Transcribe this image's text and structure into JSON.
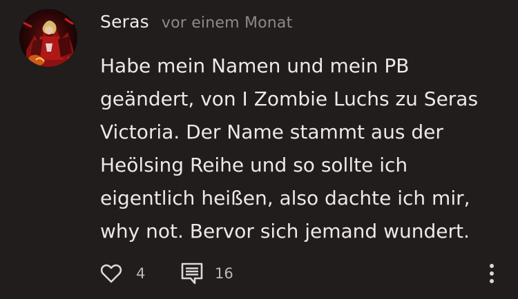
{
  "comment": {
    "author": "Seras",
    "timestamp": "vor einem Monat",
    "text": "Habe mein Namen und mein PB\ngeändert, von I Zombie Luchs zu Seras\nVictoria. Der Name stammt aus der\nHeölsing Reihe und so sollte ich\neigentlich heißen, also dachte ich mir,\nwhy not. Bervor sich jemand wundert.",
    "likes": "4",
    "replies": "16"
  },
  "icons": {
    "like": "heart-outline-icon",
    "reply": "comment-bubble-icon",
    "more": "vertical-dots-icon"
  },
  "colors": {
    "background": "#211d1d",
    "text": "#ede9e9",
    "muted": "#8f8a8a",
    "icon": "#ddd9d9"
  }
}
